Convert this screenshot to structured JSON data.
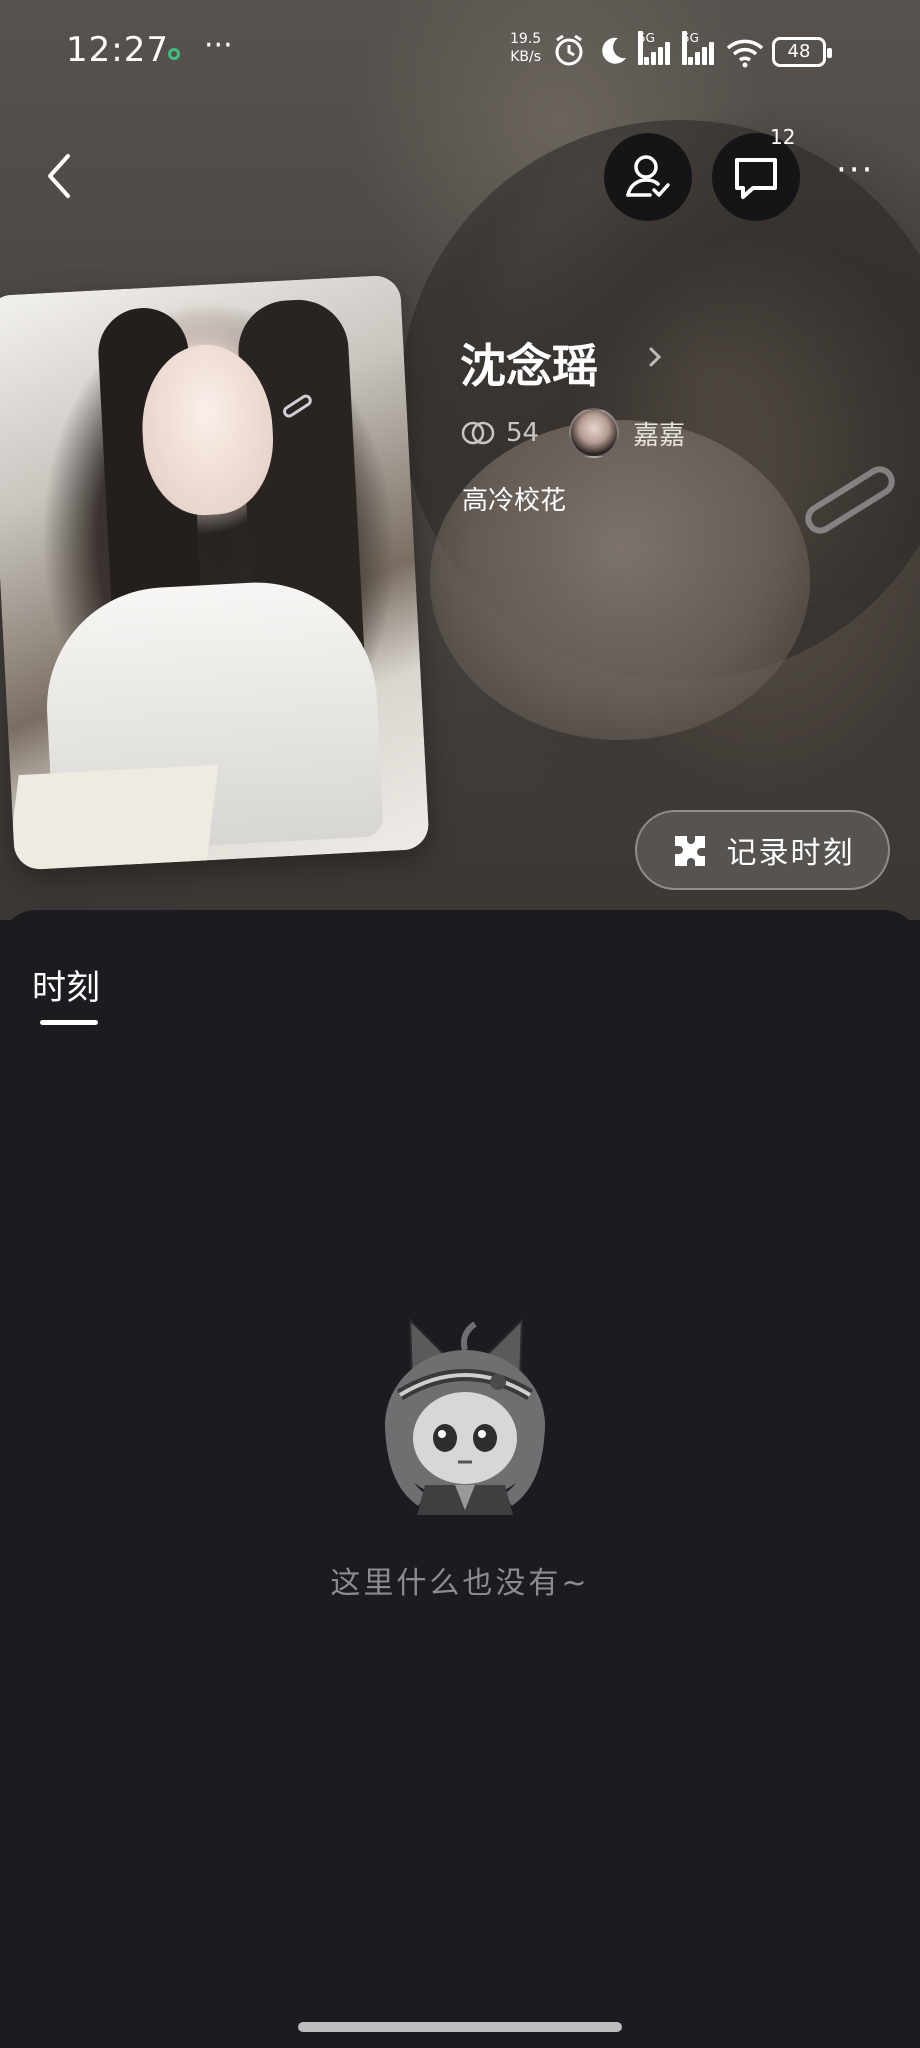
{
  "status_bar": {
    "time": "12:27",
    "more": "···",
    "net_speed_value": "19.5",
    "net_speed_unit": "KB/s",
    "sim1_label": "5G",
    "sim2_label": "5G",
    "battery": "48"
  },
  "header": {
    "chat_badge": "12",
    "more_label": "···"
  },
  "profile": {
    "name": "沈念瑶",
    "rings_count": "54",
    "partner_name": "嘉嘉",
    "tag": "高冷校花"
  },
  "actions": {
    "record_label": "记录时刻"
  },
  "tabs": [
    {
      "label": "时刻",
      "active": true
    }
  ],
  "empty_state": {
    "message": "这里什么也没有~"
  },
  "colors": {
    "panel_bg": "#1b1c1f",
    "accent_white": "#ffffff",
    "muted_text": "#8c8c8f"
  }
}
